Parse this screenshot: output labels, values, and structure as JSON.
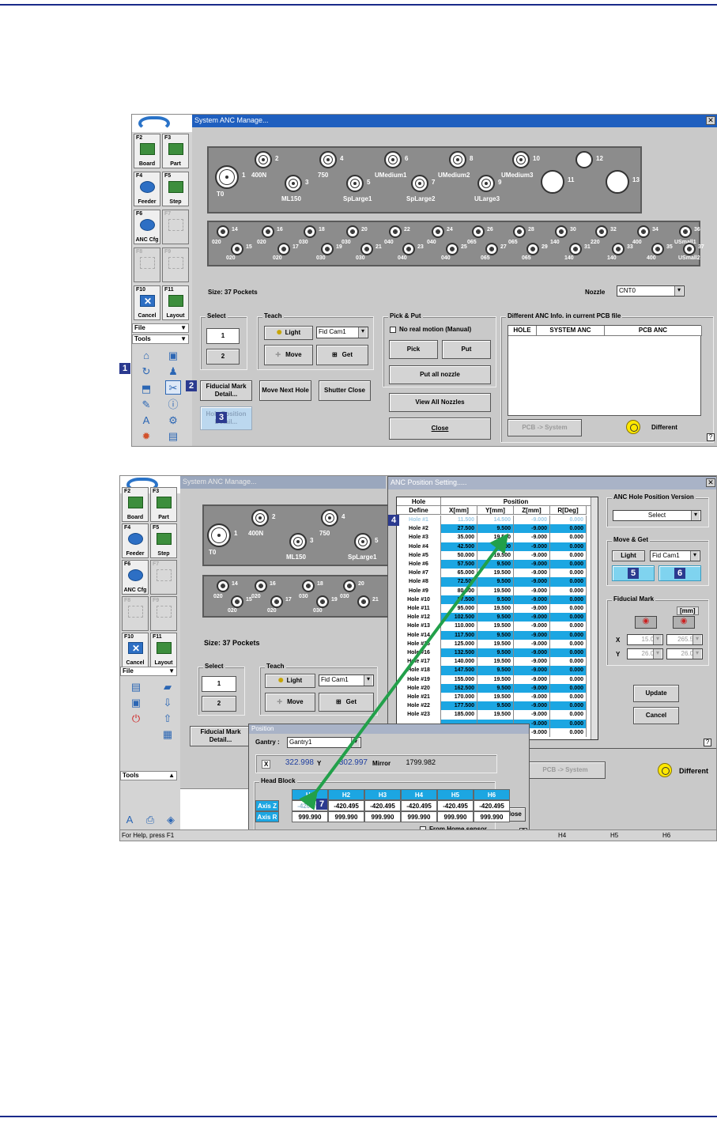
{
  "top_window": {
    "title": "System ANC Manage...",
    "fkeys": [
      {
        "key": "F2",
        "label": "Board"
      },
      {
        "key": "F3",
        "label": "Part"
      },
      {
        "key": "F4",
        "label": "Feeder"
      },
      {
        "key": "F5",
        "label": "Step"
      },
      {
        "key": "F6",
        "label": "ANC Cfg"
      },
      {
        "key": "F7",
        "label": ""
      },
      {
        "key": "F8",
        "label": ""
      },
      {
        "key": "F9",
        "label": ""
      },
      {
        "key": "F10",
        "label": "Cancel"
      },
      {
        "key": "F11",
        "label": "Layout"
      }
    ],
    "file_menu": "File",
    "tools_menu": "Tools",
    "large_nozzles": [
      {
        "num": "1",
        "name": "T0"
      },
      {
        "num": "2",
        "name": "400N"
      },
      {
        "num": "3",
        "name": "ML150"
      },
      {
        "num": "4",
        "name": "750"
      },
      {
        "num": "5",
        "name": "SpLarge1"
      },
      {
        "num": "6",
        "name": "UMedium1"
      },
      {
        "num": "7",
        "name": "SpLarge2"
      },
      {
        "num": "8",
        "name": "UMedium2"
      },
      {
        "num": "9",
        "name": "ULarge3"
      },
      {
        "num": "10",
        "name": "UMedium3"
      },
      {
        "num": "11",
        "name": ""
      },
      {
        "num": "12",
        "name": ""
      },
      {
        "num": "13",
        "name": ""
      }
    ],
    "small_nozzles": [
      {
        "num": "14",
        "name": "020"
      },
      {
        "num": "15",
        "name": "020"
      },
      {
        "num": "16",
        "name": "020"
      },
      {
        "num": "17",
        "name": "020"
      },
      {
        "num": "18",
        "name": "030"
      },
      {
        "num": "19",
        "name": "030"
      },
      {
        "num": "20",
        "name": "030"
      },
      {
        "num": "21",
        "name": "030"
      },
      {
        "num": "22",
        "name": "040"
      },
      {
        "num": "23",
        "name": "040"
      },
      {
        "num": "24",
        "name": "040"
      },
      {
        "num": "25",
        "name": "040"
      },
      {
        "num": "26",
        "name": "065"
      },
      {
        "num": "27",
        "name": "065"
      },
      {
        "num": "28",
        "name": "065"
      },
      {
        "num": "29",
        "name": "065"
      },
      {
        "num": "30",
        "name": "140"
      },
      {
        "num": "31",
        "name": "140"
      },
      {
        "num": "32",
        "name": "220"
      },
      {
        "num": "33",
        "name": "140"
      },
      {
        "num": "34",
        "name": "400"
      },
      {
        "num": "35",
        "name": "400"
      },
      {
        "num": "36",
        "name": "USmall1"
      },
      {
        "num": "37",
        "name": "USmall2"
      }
    ],
    "size_text": "Size: 37 Pockets",
    "nozzle_label": "Nozzle",
    "nozzle_value": "CNT0",
    "select_label": "Select",
    "select_1": "1",
    "select_2": "2",
    "teach_label": "Teach",
    "light": "Light",
    "fid_cam": "Fid Cam1",
    "move": "Move",
    "get": "Get",
    "fiducial_btn": "Fiducial Mark Detail...",
    "move_next_hole": "Move Next Hole",
    "shutter_close": "Shutter Close",
    "hole_position_btn": "Hole Position Detail...",
    "pick_put_label": "Pick & Put",
    "no_real_motion": "No real motion (Manual)",
    "pick": "Pick",
    "put": "Put",
    "put_all_nozzle": "Put all nozzle",
    "view_all_nozzles": "View All Nozzles",
    "close": "Close",
    "diff_label": "Different ANC Info. in current PCB file",
    "diff_cols": [
      "HOLE",
      "SYSTEM ANC",
      "PCB ANC"
    ],
    "pcb_system": "PCB -> System",
    "different": "Different",
    "help": "?"
  },
  "callouts": [
    "1",
    "2",
    "3",
    "4",
    "5",
    "6",
    "7"
  ],
  "bottom_window": {
    "bg_title": "System ANC Manage...",
    "anc_title": "ANC Position Setting.....",
    "size_text": "Size: 37 Pockets",
    "large_nozzles": [
      {
        "num": "1",
        "name": "T0"
      },
      {
        "num": "2",
        "name": "400N"
      },
      {
        "num": "3",
        "name": "ML150"
      },
      {
        "num": "4",
        "name": "750"
      },
      {
        "num": "5",
        "name": "SpLarge1"
      },
      {
        "num": "",
        "name": "U"
      }
    ],
    "small_nozzles": [
      {
        "num": "14",
        "name": "020"
      },
      {
        "num": "15",
        "name": "020"
      },
      {
        "num": "16",
        "name": "020"
      },
      {
        "num": "17",
        "name": "020"
      },
      {
        "num": "18",
        "name": "030"
      },
      {
        "num": "19",
        "name": "030"
      },
      {
        "num": "20",
        "name": "030"
      },
      {
        "num": "21",
        "name": ""
      }
    ],
    "select_label": "Select",
    "select_1": "1",
    "select_2": "2",
    "teach_label": "Teach",
    "light": "Light",
    "fid_cam": "Fid Cam1",
    "move": "Move",
    "get": "Get",
    "fiducial_btn": "Fiducial Mark Detail...",
    "file_menu": "File",
    "tools_menu": "Tools",
    "fkeys": [
      {
        "key": "F2",
        "label": "Board"
      },
      {
        "key": "F3",
        "label": "Part"
      },
      {
        "key": "F4",
        "label": "Feeder"
      },
      {
        "key": "F5",
        "label": "Step"
      },
      {
        "key": "F6",
        "label": "ANC Cfg"
      },
      {
        "key": "F7",
        "label": ""
      },
      {
        "key": "F8",
        "label": ""
      },
      {
        "key": "F9",
        "label": ""
      },
      {
        "key": "F10",
        "label": "Cancel"
      },
      {
        "key": "F11",
        "label": "Layout"
      }
    ],
    "grid_head": {
      "hole": "Hole",
      "define": "Define",
      "position": "Position",
      "x": "X[mm]",
      "y": "Y[mm]",
      "z": "Z[mm]",
      "r": "R[Deg]"
    },
    "holes": [
      [
        "Hole #1",
        "11.500",
        "14.500",
        "-9.000",
        "0.000"
      ],
      [
        "Hole #2",
        "27.500",
        "9.500",
        "-9.000",
        "0.000"
      ],
      [
        "Hole #3",
        "35.000",
        "19.500",
        "-9.000",
        "0.000"
      ],
      [
        "Hole #4",
        "42.500",
        "9.500",
        "-9.000",
        "0.000"
      ],
      [
        "Hole #5",
        "50.000",
        "19.500",
        "-9.000",
        "0.000"
      ],
      [
        "Hole #6",
        "57.500",
        "9.500",
        "-9.000",
        "0.000"
      ],
      [
        "Hole #7",
        "65.000",
        "19.500",
        "-9.000",
        "0.000"
      ],
      [
        "Hole #8",
        "72.500",
        "9.500",
        "-9.000",
        "0.000"
      ],
      [
        "Hole #9",
        "80.000",
        "19.500",
        "-9.000",
        "0.000"
      ],
      [
        "Hole #10",
        "87.500",
        "9.500",
        "-9.000",
        "0.000"
      ],
      [
        "Hole #11",
        "95.000",
        "19.500",
        "-9.000",
        "0.000"
      ],
      [
        "Hole #12",
        "102.500",
        "9.500",
        "-9.000",
        "0.000"
      ],
      [
        "Hole #13",
        "110.000",
        "19.500",
        "-9.000",
        "0.000"
      ],
      [
        "Hole #14",
        "117.500",
        "9.500",
        "-9.000",
        "0.000"
      ],
      [
        "Hole #15",
        "125.000",
        "19.500",
        "-9.000",
        "0.000"
      ],
      [
        "Hole #16",
        "132.500",
        "9.500",
        "-9.000",
        "0.000"
      ],
      [
        "Hole #17",
        "140.000",
        "19.500",
        "-9.000",
        "0.000"
      ],
      [
        "Hole #18",
        "147.500",
        "9.500",
        "-9.000",
        "0.000"
      ],
      [
        "Hole #19",
        "155.000",
        "19.500",
        "-9.000",
        "0.000"
      ],
      [
        "Hole #20",
        "162.500",
        "9.500",
        "-9.000",
        "0.000"
      ],
      [
        "Hole #21",
        "170.000",
        "19.500",
        "-9.000",
        "0.000"
      ],
      [
        "Hole #22",
        "177.500",
        "9.500",
        "-9.000",
        "0.000"
      ],
      [
        "Hole #23",
        "185.000",
        "19.500",
        "-9.000",
        "0.000"
      ],
      [
        "",
        "",
        "",
        "-9.000",
        "0.000"
      ],
      [
        "",
        "",
        "",
        "-9.000",
        "0.000"
      ]
    ],
    "version_label": "ANC Hole Position Version",
    "version_select": "Select",
    "move_get_label": "Move & Get",
    "fid_cam_r": "Fid Cam1",
    "fiducial_label": "Fiducial Mark",
    "mm": "[mm]",
    "fid_x_label": "X",
    "fid_y_label": "Y",
    "fid_x1": "15.000",
    "fid_x2": "265.500",
    "fid_y1": "26.000",
    "fid_y2": "26.000",
    "update": "Update",
    "cancel": "Cancel",
    "position_title": "Position",
    "gantry_label": "Gantry :",
    "gantry_value": "Gantry1",
    "x_label": "X",
    "x_value": "322.998",
    "y_label": "Y",
    "y_value": "302.997",
    "mirror_label": "Mirror",
    "mirror_value": "1799.982",
    "head_block_label": "Head Block",
    "heads": [
      "H1",
      "H2",
      "H3",
      "H4",
      "H5",
      "H6"
    ],
    "axis_z_label": "Axis Z",
    "axis_r_label": "Axis R",
    "axis_z": [
      "-420.495",
      "-420.495",
      "-420.495",
      "-420.495",
      "-420.495",
      "-420.495"
    ],
    "axis_r": [
      "999.990",
      "999.990",
      "999.990",
      "999.990",
      "999.990",
      "999.990"
    ],
    "pos_close": "Close",
    "from_home": "From Home sensor",
    "pcb_system": "PCB -> System",
    "different": "Different",
    "status_help": "For Help, press F1",
    "status_h4": "H4",
    "status_h5": "H5",
    "status_h6": "H6"
  },
  "colors": {
    "arrow": "#22a04a",
    "callout": "#2b3a8f",
    "highlight": "#1ca6e2",
    "title_bar": "#1f5fbf",
    "rule": "#1a2a8a"
  }
}
